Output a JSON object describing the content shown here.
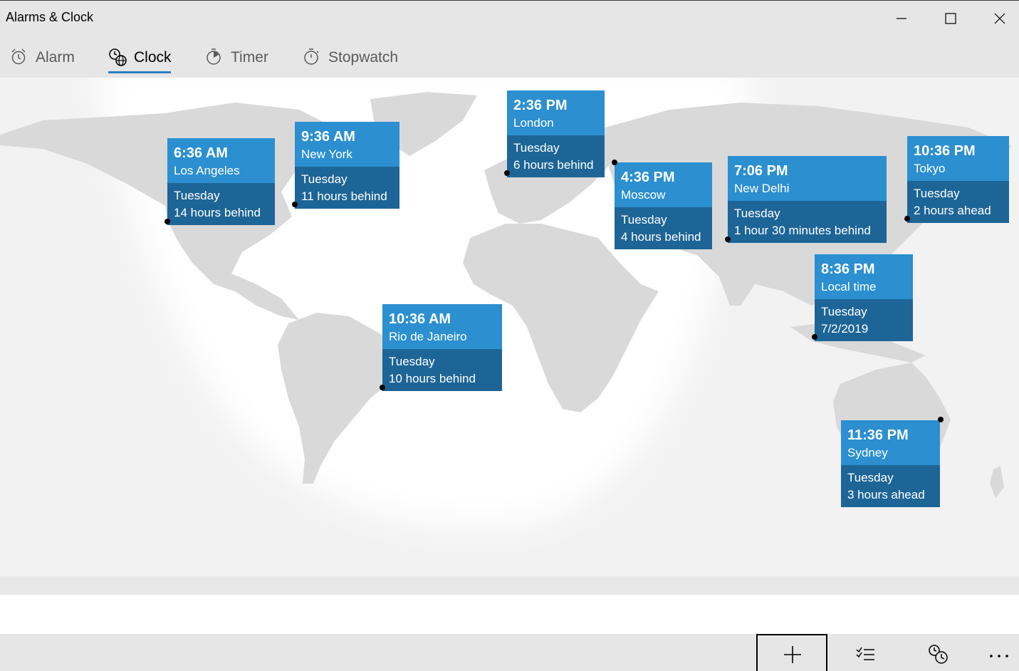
{
  "window": {
    "title": "Alarms & Clock"
  },
  "tabs": [
    {
      "label": "Alarm",
      "icon": "alarm-clock-icon",
      "active": false
    },
    {
      "label": "Clock",
      "icon": "world-clock-icon",
      "active": true
    },
    {
      "label": "Timer",
      "icon": "timer-icon",
      "active": false
    },
    {
      "label": "Stopwatch",
      "icon": "stopwatch-icon",
      "active": false
    }
  ],
  "clocks": [
    {
      "time": "6:36 AM",
      "city": "Los Angeles",
      "day": "Tuesday",
      "diff": "14 hours behind"
    },
    {
      "time": "9:36 AM",
      "city": "New York",
      "day": "Tuesday",
      "diff": "11 hours behind"
    },
    {
      "time": "2:36 PM",
      "city": "London",
      "day": "Tuesday",
      "diff": "6 hours behind"
    },
    {
      "time": "4:36 PM",
      "city": "Moscow",
      "day": "Tuesday",
      "diff": "4 hours behind"
    },
    {
      "time": "7:06 PM",
      "city": "New Delhi",
      "day": "Tuesday",
      "diff": "1 hour 30 minutes behind"
    },
    {
      "time": "10:36 PM",
      "city": "Tokyo",
      "day": "Tuesday",
      "diff": "2 hours ahead"
    },
    {
      "time": "8:36 PM",
      "city": "Local time",
      "day": "Tuesday",
      "diff": "7/2/2019"
    },
    {
      "time": "10:36 AM",
      "city": "Rio de Janeiro",
      "day": "Tuesday",
      "diff": "10 hours behind"
    },
    {
      "time": "11:36 PM",
      "city": "Sydney",
      "day": "Tuesday",
      "diff": "3 hours ahead"
    }
  ],
  "commands": [
    {
      "name": "add-button",
      "icon": "plus-icon"
    },
    {
      "name": "select-button",
      "icon": "checklist-icon"
    },
    {
      "name": "compare-button",
      "icon": "compare-clock-icon"
    },
    {
      "name": "more-button",
      "icon": "more-icon"
    }
  ],
  "colors": {
    "card_top": "#2b8fd0",
    "card_bottom": "#1d6596",
    "accent": "#2f7fc1",
    "map_land": "#d9d9d9",
    "map_background": "#f2f2f2"
  }
}
